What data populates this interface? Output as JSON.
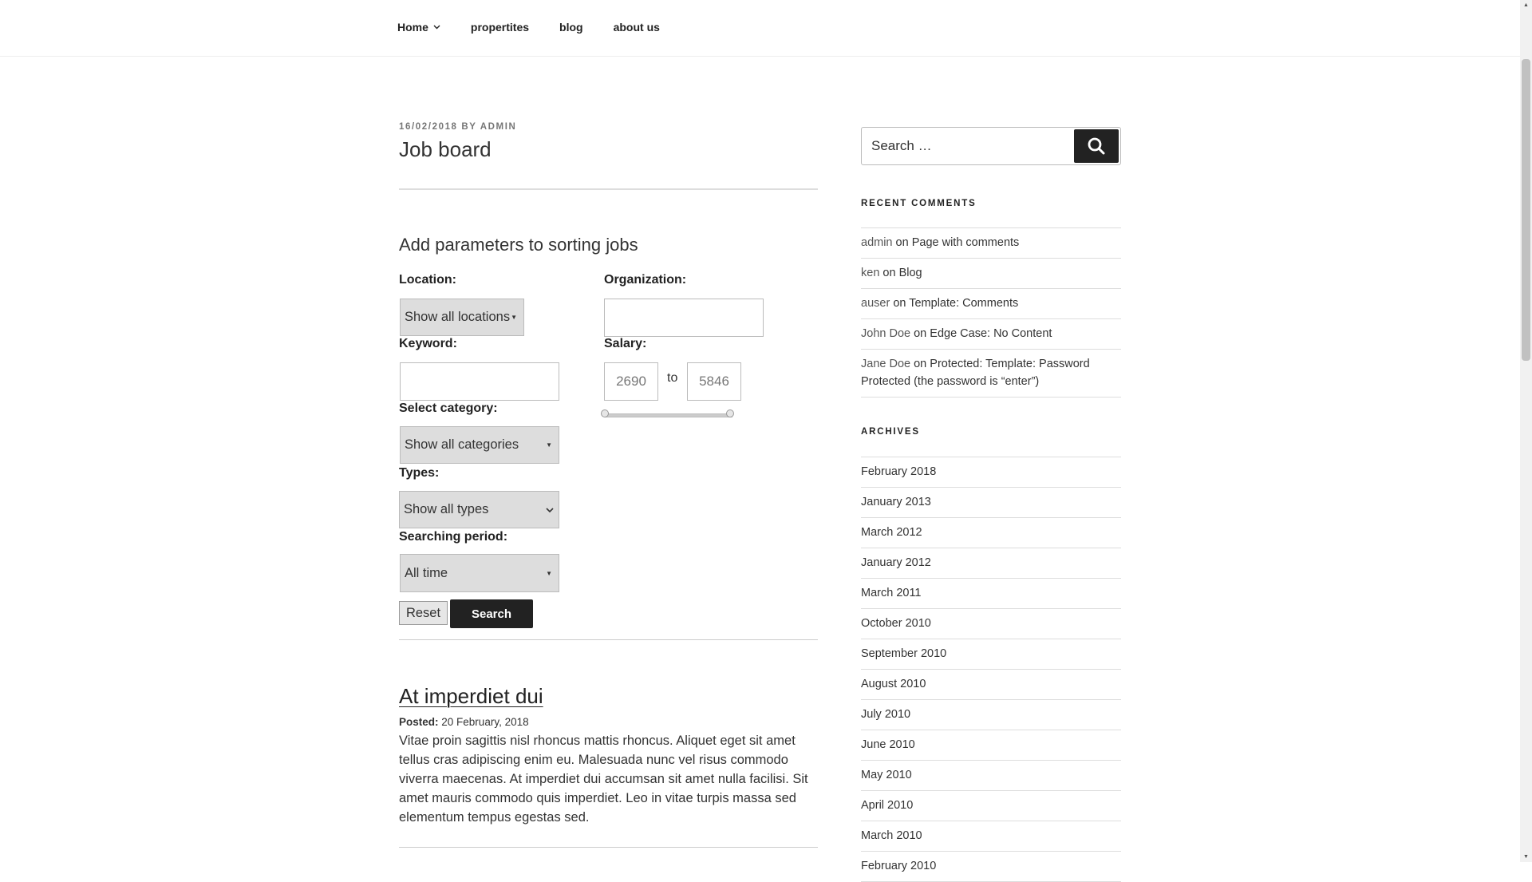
{
  "nav": {
    "items": [
      {
        "label": "Home",
        "has_dropdown": true
      },
      {
        "label": "propertites"
      },
      {
        "label": "blog"
      },
      {
        "label": "about us"
      }
    ]
  },
  "post": {
    "date": "16/02/2018",
    "by": "BY",
    "author": "ADMIN",
    "title": "Job board"
  },
  "form": {
    "heading": "Add parameters to sorting jobs",
    "location_label": "Location:",
    "location_value": "Show all locations",
    "organization_label": "Organization:",
    "organization_value": "",
    "keyword_label": "Keyword:",
    "keyword_value": "",
    "salary_label": "Salary:",
    "salary_min": "2690",
    "salary_to": "to",
    "salary_max": "5846",
    "category_label": "Select category:",
    "category_value": "Show all categories",
    "types_label": "Types:",
    "types_value": "Show all types",
    "period_label": "Searching period:",
    "period_value": "All time",
    "reset_label": "Reset",
    "search_label": "Search"
  },
  "job": {
    "title": "At imperdiet dui",
    "posted_label": "Posted:",
    "posted_date": "20 February, 2018",
    "description": "Vitae proin sagittis nisl rhoncus mattis rhoncus. Aliquet eget sit amet tellus cras adipiscing enim eu. Malesuada nunc vel risus commodo viverra maecenas. At imperdiet dui accumsan sit amet nulla facilisi. Sit amet mauris commodo quis imperdiet. Leo in vitae turpis massa sed elementum tempus egestas sed."
  },
  "sidebar": {
    "search_placeholder": "Search …",
    "recent_comments_title": "RECENT COMMENTS",
    "recent_comments": [
      {
        "author": "admin",
        "on": "on",
        "post": "Page with comments"
      },
      {
        "author": "ken",
        "on": "on",
        "post": "Blog"
      },
      {
        "author": "auser",
        "on": "on",
        "post": "Template: Comments"
      },
      {
        "author": "John Doe",
        "on": "on",
        "post": "Edge Case: No Content"
      },
      {
        "author": "Jane Doe",
        "on": "on",
        "post": "Protected: Template: Password Protected (the password is “enter”)"
      }
    ],
    "archives_title": "ARCHIVES",
    "archives": [
      "February 2018",
      "January 2013",
      "March 2012",
      "January 2012",
      "March 2011",
      "October 2010",
      "September 2010",
      "August 2010",
      "July 2010",
      "June 2010",
      "May 2010",
      "April 2010",
      "March 2010",
      "February 2010"
    ]
  },
  "colors": {
    "accent_dark": "#222222",
    "border": "#dddddd",
    "select_bg": "#dddddd"
  }
}
